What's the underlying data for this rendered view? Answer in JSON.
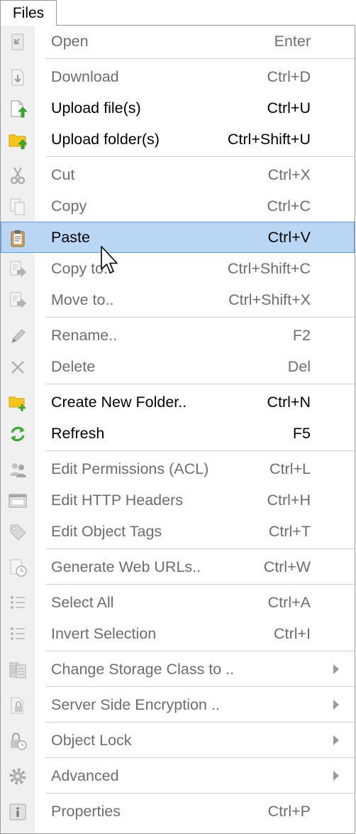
{
  "menu_title": "Files",
  "items": [
    {
      "type": "item",
      "name": "open",
      "icon": "open-icon",
      "label": "Open",
      "shortcut": "Enter",
      "enabled": false
    },
    {
      "type": "sep"
    },
    {
      "type": "item",
      "name": "download",
      "icon": "download-icon",
      "label": "Download",
      "shortcut": "Ctrl+D",
      "enabled": false
    },
    {
      "type": "item",
      "name": "upload-files",
      "icon": "upload-file-icon",
      "label": "Upload file(s)",
      "shortcut": "Ctrl+U",
      "enabled": true
    },
    {
      "type": "item",
      "name": "upload-folders",
      "icon": "upload-folder-icon",
      "label": "Upload folder(s)",
      "shortcut": "Ctrl+Shift+U",
      "enabled": true
    },
    {
      "type": "sep"
    },
    {
      "type": "item",
      "name": "cut",
      "icon": "scissors-icon",
      "label": "Cut",
      "shortcut": "Ctrl+X",
      "enabled": false
    },
    {
      "type": "item",
      "name": "copy",
      "icon": "copy-icon",
      "label": "Copy",
      "shortcut": "Ctrl+C",
      "enabled": false
    },
    {
      "type": "item",
      "name": "paste",
      "icon": "clipboard-icon",
      "label": "Paste",
      "shortcut": "Ctrl+V",
      "enabled": true,
      "highlighted": true
    },
    {
      "type": "item",
      "name": "copy-to",
      "icon": "copy-to-icon",
      "label": "Copy to..",
      "shortcut": "Ctrl+Shift+C",
      "enabled": false
    },
    {
      "type": "item",
      "name": "move-to",
      "icon": "move-to-icon",
      "label": "Move to..",
      "shortcut": "Ctrl+Shift+X",
      "enabled": false
    },
    {
      "type": "sep"
    },
    {
      "type": "item",
      "name": "rename",
      "icon": "pencil-icon",
      "label": "Rename..",
      "shortcut": "F2",
      "enabled": false
    },
    {
      "type": "item",
      "name": "delete",
      "icon": "delete-x-icon",
      "label": "Delete",
      "shortcut": "Del",
      "enabled": false
    },
    {
      "type": "sep"
    },
    {
      "type": "item",
      "name": "create-new-folder",
      "icon": "new-folder-icon",
      "label": "Create New Folder..",
      "shortcut": "Ctrl+N",
      "enabled": true
    },
    {
      "type": "item",
      "name": "refresh",
      "icon": "refresh-icon",
      "label": "Refresh",
      "shortcut": "F5",
      "enabled": true
    },
    {
      "type": "sep"
    },
    {
      "type": "item",
      "name": "edit-permissions",
      "icon": "users-icon",
      "label": "Edit Permissions (ACL)",
      "shortcut": "Ctrl+L",
      "enabled": false
    },
    {
      "type": "item",
      "name": "edit-http-headers",
      "icon": "window-icon",
      "label": "Edit HTTP Headers",
      "shortcut": "Ctrl+H",
      "enabled": false
    },
    {
      "type": "item",
      "name": "edit-object-tags",
      "icon": "tag-icon",
      "label": "Edit Object Tags",
      "shortcut": "Ctrl+T",
      "enabled": false
    },
    {
      "type": "sep"
    },
    {
      "type": "item",
      "name": "generate-web-urls",
      "icon": "web-url-clock-icon",
      "label": "Generate Web URLs..",
      "shortcut": "Ctrl+W",
      "enabled": false
    },
    {
      "type": "sep"
    },
    {
      "type": "item",
      "name": "select-all",
      "icon": "list-icon",
      "label": "Select All",
      "shortcut": "Ctrl+A",
      "enabled": false
    },
    {
      "type": "item",
      "name": "invert-selection",
      "icon": "list-invert-icon",
      "label": "Invert Selection",
      "shortcut": "Ctrl+I",
      "enabled": false
    },
    {
      "type": "sep"
    },
    {
      "type": "item",
      "name": "change-storage-class",
      "icon": "storage-class-icon",
      "label": "Change Storage Class to ..",
      "submenu": true,
      "enabled": false
    },
    {
      "type": "sep"
    },
    {
      "type": "item",
      "name": "server-side-encryption",
      "icon": "encryption-lock-icon",
      "label": "Server Side Encryption ..",
      "submenu": true,
      "enabled": false
    },
    {
      "type": "sep"
    },
    {
      "type": "item",
      "name": "object-lock",
      "icon": "lock-clock-icon",
      "label": "Object Lock",
      "submenu": true,
      "enabled": false
    },
    {
      "type": "sep"
    },
    {
      "type": "item",
      "name": "advanced",
      "icon": "gear-icon",
      "label": "Advanced",
      "submenu": true,
      "enabled": false
    },
    {
      "type": "sep"
    },
    {
      "type": "item",
      "name": "properties",
      "icon": "info-icon",
      "label": "Properties",
      "shortcut": "Ctrl+P",
      "enabled": false
    }
  ],
  "colors": {
    "highlight_bg": "#b9d7f4",
    "highlight_border": "#5b9bd8",
    "disabled_text": "#6d6d6d",
    "gutter": "#f0f0f0",
    "icon_green": "#3aaa35",
    "icon_folder": "#f5c518"
  }
}
